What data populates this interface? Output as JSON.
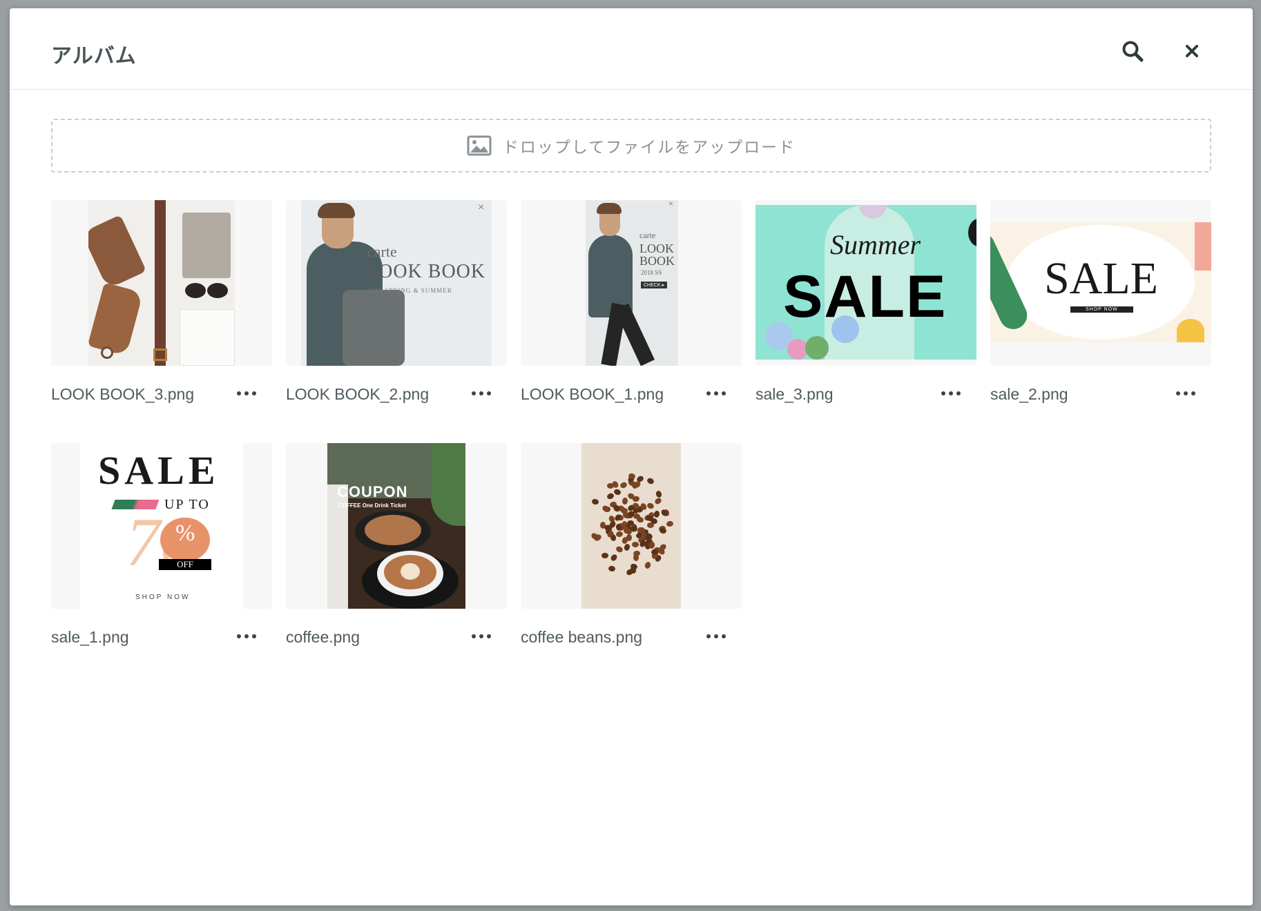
{
  "header": {
    "title": "アルバム",
    "search_icon": "search-icon",
    "close_icon": "close-icon"
  },
  "dropzone": {
    "icon": "image-icon",
    "label": "ドロップしてファイルをアップロード"
  },
  "items": [
    {
      "filename": "LOOK BOOK_3.png"
    },
    {
      "filename": "LOOK BOOK_2.png",
      "brand": "carte",
      "heading": "LOOK BOOK",
      "sub": "2018 SPRING & SUMMER"
    },
    {
      "filename": "LOOK BOOK_1.png",
      "brand": "carte",
      "heading_1": "LOOK",
      "heading_2": "BOOK",
      "sub": "2018 SS",
      "cta": "CHECK ▸"
    },
    {
      "filename": "sale_3.png",
      "script_text": "Summer",
      "heading": "SALE"
    },
    {
      "filename": "sale_2.png",
      "heading": "SALE",
      "cta": "SHOP NOW"
    },
    {
      "filename": "sale_1.png",
      "heading": "SALE",
      "up_to": "UP TO",
      "number": "70",
      "percent": "%",
      "off": "OFF",
      "cta": "SHOP NOW"
    },
    {
      "filename": "coffee.png",
      "heading": "COUPON",
      "sub": "COFFEE One Drink Ticket"
    },
    {
      "filename": "coffee beans.png"
    }
  ],
  "more_icon": "more-horizontal-icon",
  "colors": {
    "backdrop": "#9aa0a2",
    "title_text": "#4a5457",
    "filename_text": "#4f5a5d",
    "mint": "#8fe3d2",
    "coral": "#e8926a"
  }
}
